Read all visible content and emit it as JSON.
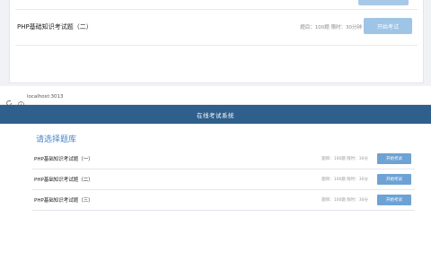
{
  "top_panel": {
    "exam_title": "PHP基础知识考试题（二）",
    "exam_meta": "题目：100题 限时：30分钟",
    "start_label": "开始考试"
  },
  "browser": {
    "url": "localhost:3013"
  },
  "header": {
    "title": "在线考试系统"
  },
  "main": {
    "bank_link": "请选择题库",
    "exams": [
      {
        "title": "PHP基础知识考试题（一）",
        "meta": "题目：100题 限时：30分",
        "start_label": "开始考试"
      },
      {
        "title": "PHP基础知识考试题（二）",
        "meta": "题目：100题 限时：30分",
        "start_label": "开始考试"
      },
      {
        "title": "PHP基础知识考试题（三）",
        "meta": "题目：100题 限时：30分",
        "start_label": "开始考试"
      }
    ]
  }
}
